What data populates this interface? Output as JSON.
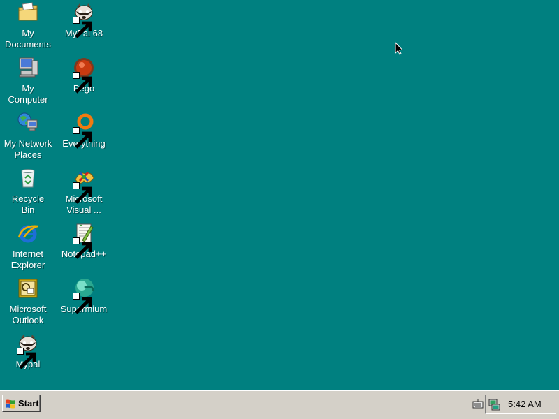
{
  "desktop": {
    "background_color": "#008080",
    "icons": [
      {
        "label": "My\nDocuments",
        "icon": "folder-documents-icon"
      },
      {
        "label": "MyPal 68",
        "icon": "raccoon-icon",
        "shortcut": true
      },
      {
        "label": "My\nComputer",
        "icon": "computer-icon"
      },
      {
        "label": "Pego",
        "icon": "pego-icon",
        "shortcut": true
      },
      {
        "label": "My Network\nPlaces",
        "icon": "network-globe-icon"
      },
      {
        "label": "Everything",
        "icon": "everything-ring-icon",
        "shortcut": true
      },
      {
        "label": "Recycle\nBin",
        "icon": "recycle-bin-icon"
      },
      {
        "label": "Microsoft\nVisual ...",
        "icon": "visual-studio-icon",
        "shortcut": true
      },
      {
        "label": "Internet\nExplorer",
        "icon": "internet-explorer-icon"
      },
      {
        "label": "Notepad++",
        "icon": "notepad-plus-plus-icon",
        "shortcut": true
      },
      {
        "label": "Microsoft\nOutlook",
        "icon": "outlook-icon"
      },
      {
        "label": "Supermium",
        "icon": "supermium-icon",
        "shortcut": true
      },
      {
        "label": "Mypal",
        "icon": "raccoon-icon",
        "shortcut": true
      }
    ]
  },
  "taskbar": {
    "start_label": "Start",
    "clock": "5:42 AM"
  }
}
